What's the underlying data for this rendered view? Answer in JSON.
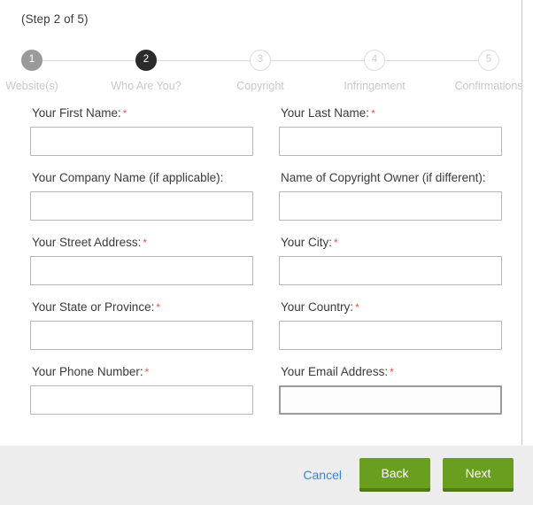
{
  "wizard": {
    "step_caption": "(Step 2 of 5)",
    "steps": [
      {
        "number": "1",
        "label": "Website(s)",
        "state": "done"
      },
      {
        "number": "2",
        "label": "Who Are You?",
        "state": "current"
      },
      {
        "number": "3",
        "label": "Copyright",
        "state": "todo"
      },
      {
        "number": "4",
        "label": "Infringement",
        "state": "todo"
      },
      {
        "number": "5",
        "label": "Confirmations",
        "state": "todo"
      }
    ]
  },
  "form": {
    "rows": [
      {
        "left": {
          "label": "Your First Name:",
          "required": "*",
          "value": "",
          "placeholder": ""
        },
        "right": {
          "label": "Your Last Name:",
          "required": "*",
          "value": "",
          "placeholder": ""
        }
      },
      {
        "left": {
          "label": "Your Company Name (if applicable):",
          "required": "",
          "value": "",
          "placeholder": ""
        },
        "right": {
          "label": "Name of Copyright Owner (if different):",
          "required": "",
          "value": "",
          "placeholder": ""
        }
      },
      {
        "left": {
          "label": "Your Street Address:",
          "required": "*",
          "value": "",
          "placeholder": ""
        },
        "right": {
          "label": "Your City:",
          "required": "*",
          "value": "",
          "placeholder": ""
        }
      },
      {
        "left": {
          "label": "Your State or Province:",
          "required": "*",
          "value": "",
          "placeholder": ""
        },
        "right": {
          "label": "Your Country:",
          "required": "*",
          "value": "",
          "placeholder": ""
        }
      },
      {
        "left": {
          "label": "Your Phone Number:",
          "required": "*",
          "value": "",
          "placeholder": ""
        },
        "right": {
          "label": "Your Email Address:",
          "required": "*",
          "value": "",
          "placeholder": "",
          "focused": true
        }
      }
    ]
  },
  "footer": {
    "cancel_label": "Cancel",
    "back_label": "Back",
    "next_label": "Next"
  },
  "colors": {
    "button_green": "#6a9e1f",
    "button_green_dark": "#4f7a14",
    "link_blue": "#3f82d2",
    "required_red": "#f0534f",
    "current_step": "#2b2b2b",
    "done_step": "#9a9a9a",
    "footer_bg": "#ededed"
  }
}
